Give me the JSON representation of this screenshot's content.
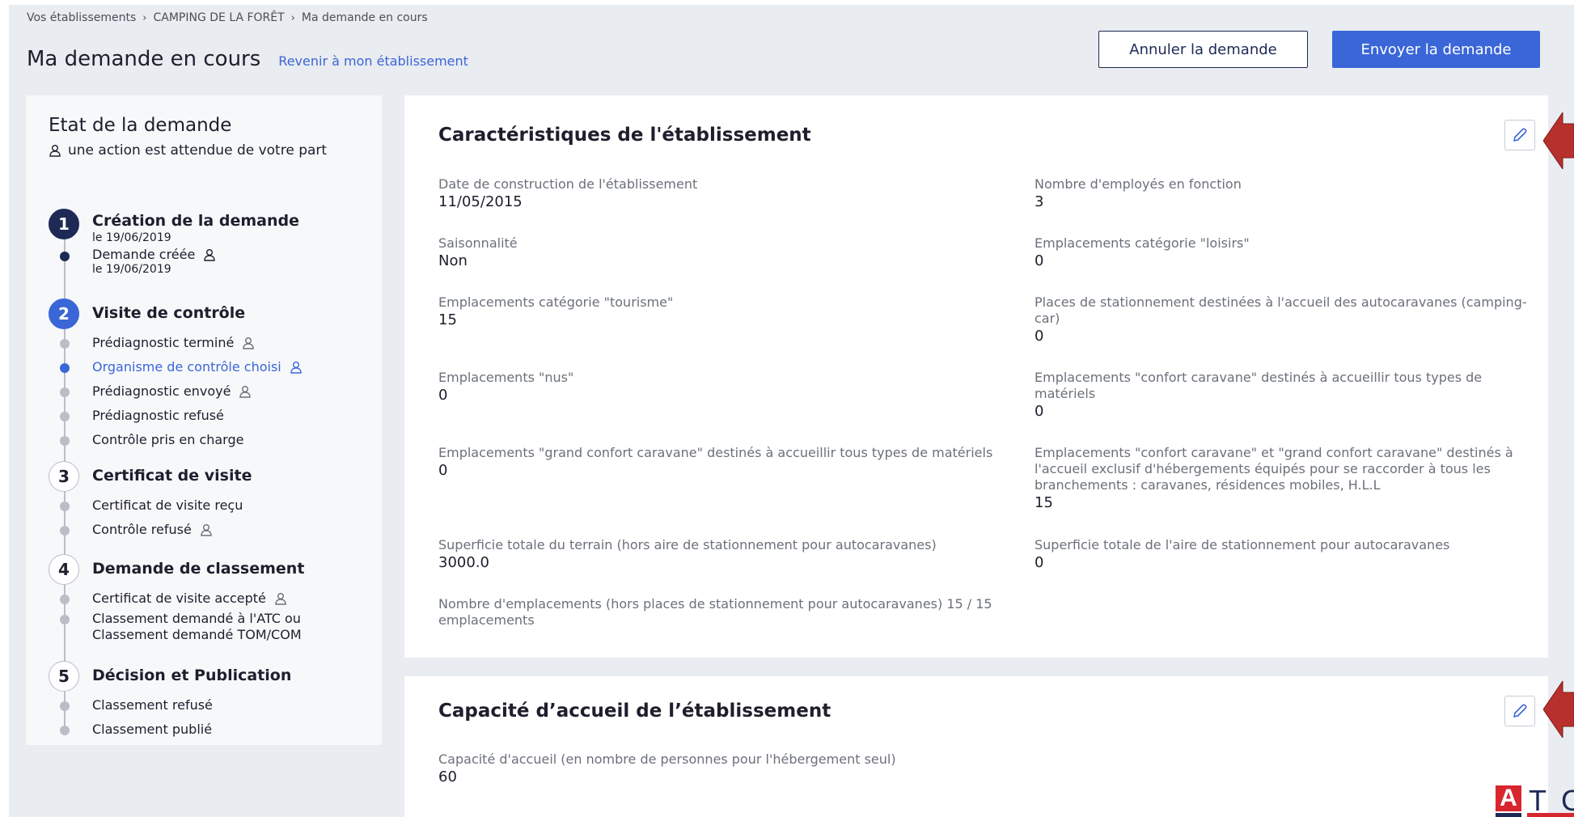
{
  "breadcrumb": {
    "items": [
      "Vos établissements",
      "CAMPING DE LA FORÊT",
      "Ma demande en cours"
    ],
    "separator": "›"
  },
  "header": {
    "title": "Ma demande en cours",
    "back_link": "Revenir à mon établissement",
    "cancel_button": "Annuler la demande",
    "send_button": "Envoyer la demande"
  },
  "sidebar": {
    "title": "Etat de la demande",
    "subtitle": "une action est attendue de votre part",
    "steps": [
      {
        "number": "1",
        "label": "Création de la demande",
        "date": "le 19/06/2019",
        "state": "done",
        "substeps": [
          {
            "label": "Demande créée",
            "date": "le 19/06/2019",
            "user_action": true,
            "state": "done"
          }
        ]
      },
      {
        "number": "2",
        "label": "Visite de contrôle",
        "state": "current",
        "substeps": [
          {
            "label": "Prédiagnostic terminé",
            "user_action": true,
            "state": "todo"
          },
          {
            "label": "Organisme de contrôle choisi",
            "user_action": true,
            "state": "current"
          },
          {
            "label": "Prédiagnostic envoyé",
            "user_action": true,
            "state": "todo"
          },
          {
            "label": "Prédiagnostic refusé",
            "user_action": false,
            "state": "todo"
          },
          {
            "label": "Contrôle pris en charge",
            "user_action": false,
            "state": "todo"
          }
        ]
      },
      {
        "number": "3",
        "label": "Certificat de visite",
        "state": "todo",
        "substeps": [
          {
            "label": "Certificat de visite reçu",
            "user_action": false,
            "state": "todo"
          },
          {
            "label": "Contrôle refusé",
            "user_action": true,
            "state": "todo"
          }
        ]
      },
      {
        "number": "4",
        "label": "Demande de classement",
        "state": "todo",
        "substeps": [
          {
            "label": "Certificat de visite accepté",
            "user_action": true,
            "state": "todo"
          },
          {
            "label": "Classement demandé à l'ATC ou Classement demandé TOM/COM",
            "user_action": false,
            "state": "todo"
          }
        ]
      },
      {
        "number": "5",
        "label": "Décision et Publication",
        "state": "todo",
        "substeps": [
          {
            "label": "Classement refusé",
            "user_action": false,
            "state": "todo"
          },
          {
            "label": "Classement publié",
            "user_action": false,
            "state": "todo"
          }
        ]
      }
    ]
  },
  "characteristics": {
    "title": "Caractéristiques de l'établissement",
    "fields": [
      {
        "label": "Date de construction de l'établissement",
        "value": "11/05/2015"
      },
      {
        "label": "Nombre d'employés en fonction",
        "value": "3"
      },
      {
        "label": "Saisonnalité",
        "value": "Non"
      },
      {
        "label": "Emplacements catégorie \"loisirs\"",
        "value": "0"
      },
      {
        "label": "Emplacements catégorie \"tourisme\"",
        "value": "15"
      },
      {
        "label": "Places de stationnement destinées à l'accueil des autocaravanes (camping-car)",
        "value": "0"
      },
      {
        "label": "Emplacements \"nus\"",
        "value": "0"
      },
      {
        "label": "Emplacements \"confort caravane\" destinés à accueillir tous types de matériels",
        "value": "0"
      },
      {
        "label": "Emplacements \"grand confort caravane\" destinés à accueillir tous types de matériels",
        "value": "0"
      },
      {
        "label": "Emplacements \"confort caravane\" et \"grand confort caravane\" destinés à l'accueil exclusif d'hébergements équipés pour se raccorder à tous les branchements : caravanes, résidences mobiles, H.L.L",
        "value": "15"
      },
      {
        "label": "Superficie totale du terrain (hors aire de stationnement pour autocaravanes)",
        "value": "3000.0"
      },
      {
        "label": "Superficie totale de l'aire de stationnement pour autocaravanes",
        "value": "0"
      },
      {
        "label": "Nombre d'emplacements (hors places de stationnement pour autocaravanes) 15 / 15 emplacements",
        "value": ""
      }
    ]
  },
  "capacity": {
    "title": "Capacité d’accueil de l’établissement",
    "fields": [
      {
        "label": "Capacité d'accueil (en nombre de personnes pour l'hébergement seul)",
        "value": "60"
      }
    ]
  },
  "logo": {
    "letter_a": "A",
    "rest": "TC"
  },
  "colors": {
    "primary": "#3a66d8",
    "navy": "#1e2a55",
    "background": "#e9ecf0",
    "arrow": "#b8302d",
    "logo_red": "#d8262f"
  }
}
